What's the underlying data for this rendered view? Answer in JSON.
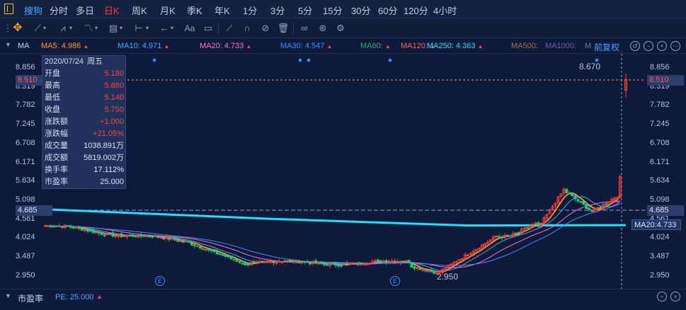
{
  "topbar": {
    "brand": "搜狗",
    "tabs": [
      "分时",
      "多日",
      "日K",
      "周K",
      "月K",
      "季K",
      "年K",
      "1分",
      "3分",
      "5分",
      "15分",
      "30分",
      "60分",
      "120分",
      "4小时"
    ],
    "active_tab": "日K"
  },
  "mabar": {
    "indicator": "MA",
    "items": [
      {
        "label": "MA5: 4.986",
        "color": "#ff9a2e",
        "arrow": "▲"
      },
      {
        "label": "MA10: 4.971",
        "color": "#4aa8ff",
        "arrow": "▲"
      },
      {
        "label": "MA20: 4.733",
        "color": "#ff6fd0",
        "arrow": "▲"
      },
      {
        "label": "MA30: 4.547",
        "color": "#3f8cff",
        "arrow": "▲"
      },
      {
        "label": "MA60:",
        "color": "#2fae6a",
        "arrow": "▲"
      },
      {
        "label": "MA120:",
        "color": "#ff5c5c",
        "arrow": "▲"
      },
      {
        "label": "MA250: 4.363",
        "color": "#1ee0ff",
        "arrow": "▲"
      },
      {
        "label": "MA500:",
        "color": "#a07a3a",
        "arrow": ""
      },
      {
        "label": "MA1000:",
        "color": "#7a5ab0",
        "arrow": ""
      },
      {
        "label": "M",
        "color": "#7a7a9a",
        "arrow": ""
      }
    ],
    "adjust": "前复权"
  },
  "info": {
    "date": "2020/07/24",
    "weekday": "周五",
    "rows": [
      {
        "k": "开盘",
        "v": "5.180",
        "c": "red"
      },
      {
        "k": "最高",
        "v": "5.880",
        "c": "red"
      },
      {
        "k": "最低",
        "v": "5.140",
        "c": "red"
      },
      {
        "k": "收盘",
        "v": "5.750",
        "c": "red"
      },
      {
        "k": "涨跌额",
        "v": "+1.000",
        "c": "red"
      },
      {
        "k": "涨跌幅",
        "v": "+21.05%",
        "c": "red"
      },
      {
        "k": "成交量",
        "v": "1038.891万",
        "c": "white"
      },
      {
        "k": "成交额",
        "v": "5819.002万",
        "c": "white"
      },
      {
        "k": "换手率",
        "v": "17.112%",
        "c": "white"
      },
      {
        "k": "市盈率",
        "v": "25.000",
        "c": "white"
      }
    ]
  },
  "axis": {
    "ticks": [
      "8.856",
      "8.319",
      "7.782",
      "7.245",
      "6.708",
      "6.171",
      "5.634",
      "5.098",
      "4.561",
      "4.024",
      "3.487",
      "2.950"
    ],
    "left_current": "8.510",
    "left_ref": "4.685",
    "right_current": "8.510",
    "right_ref": "4.685",
    "ma20_tag": "MA20:4.733"
  },
  "annotations": {
    "high_label": "8.670",
    "low_label": "2.950",
    "event_marker": "E"
  },
  "bottom": {
    "indicator": "市盈率",
    "pe_label": "PE: 25.000",
    "arrow": "▲"
  }
}
